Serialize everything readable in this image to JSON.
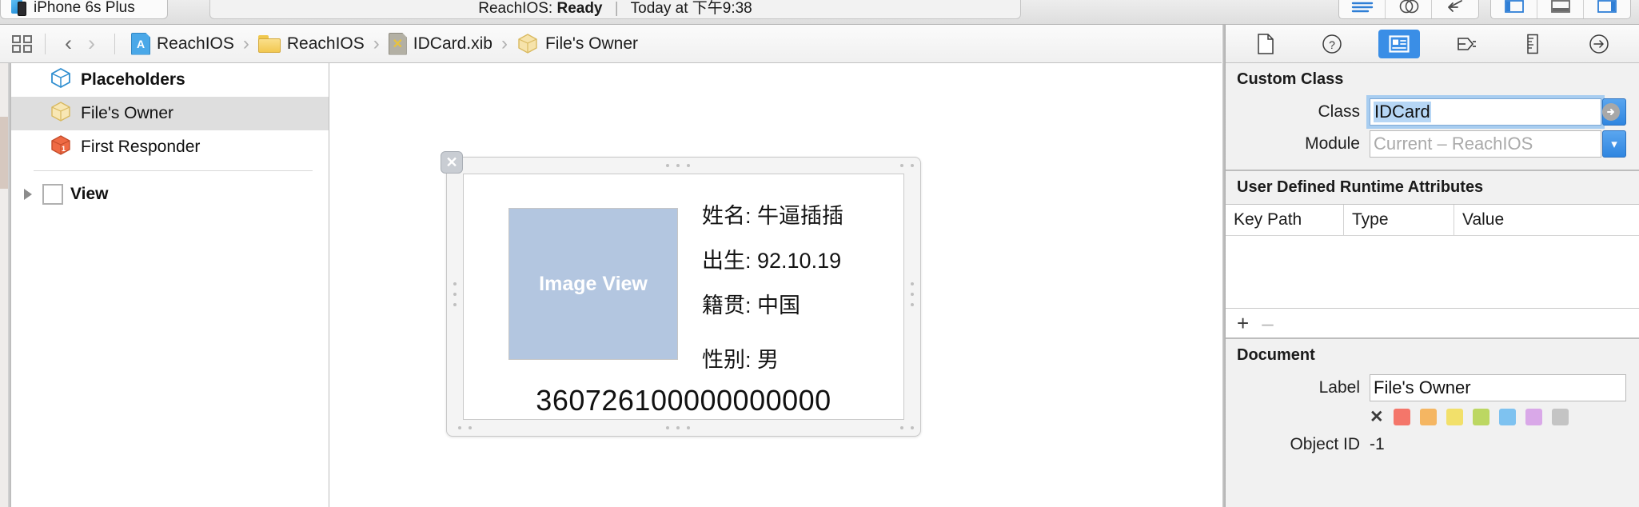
{
  "toolbar": {
    "scheme": "iPhone 6s Plus",
    "device_icon": "iphone-icon",
    "activity_prefix": "ReachIOS:",
    "activity_status": "Ready",
    "activity_separator": "|",
    "activity_time": "Today at 下午9:38",
    "editor_modes": [
      "standard-editor-icon",
      "assistant-editor-icon",
      "version-editor-icon"
    ],
    "panel_toggles": [
      "navigator-toggle-icon",
      "debug-area-toggle-icon",
      "utilities-toggle-icon"
    ]
  },
  "jumpbar": {
    "grid_icon": "related-items-icon",
    "back_icon": "back-chevron-icon",
    "forward_icon": "forward-chevron-icon",
    "separator": "›",
    "crumbs": [
      {
        "label": "ReachIOS",
        "icon": "project-icon"
      },
      {
        "label": "ReachIOS",
        "icon": "folder-icon"
      },
      {
        "label": "IDCard.xib",
        "icon": "xib-file-icon"
      },
      {
        "label": "File's Owner",
        "icon": "cube-icon"
      }
    ]
  },
  "outline": {
    "placeholders": {
      "label": "Placeholders",
      "icon": "blue-cube-icon"
    },
    "items": [
      {
        "label": "File's Owner",
        "icon": "yellow-cube-icon",
        "selected": true
      },
      {
        "label": "First Responder",
        "icon": "first-responder-icon",
        "selected": false
      }
    ],
    "view": {
      "label": "View",
      "icon": "view-square-icon",
      "disclosure": "disclosure-triangle-icon"
    }
  },
  "canvas": {
    "close_badge": "✕",
    "image_view_label": "Image View",
    "image_view_color": "#b3c6e0",
    "fields": [
      "姓名: 牛逼插插",
      "出生: 92.10.19",
      "籍贯: 中国",
      "性别: 男"
    ],
    "id_number": "360726100000000000"
  },
  "inspector": {
    "tabs": [
      {
        "name": "file-inspector",
        "icon": "file-icon",
        "active": false
      },
      {
        "name": "quick-help-inspector",
        "icon": "question-circle-icon",
        "active": false
      },
      {
        "name": "identity-inspector",
        "icon": "identity-card-icon",
        "active": true
      },
      {
        "name": "attributes-inspector",
        "icon": "attributes-slider-icon",
        "active": false
      },
      {
        "name": "size-inspector",
        "icon": "ruler-icon",
        "active": false
      },
      {
        "name": "connections-inspector",
        "icon": "arrow-circle-icon",
        "active": false
      }
    ],
    "custom_class": {
      "title": "Custom Class",
      "class_label": "Class",
      "class_value": "IDCard",
      "module_label": "Module",
      "module_placeholder": "Current – ReachIOS"
    },
    "runtime_attributes": {
      "title": "User Defined Runtime Attributes",
      "columns": [
        "Key Path",
        "Type",
        "Value"
      ],
      "rows": [],
      "add_label": "+",
      "remove_label": "–"
    },
    "document": {
      "title": "Document",
      "label_label": "Label",
      "label_value": "File's Owner",
      "clear_color": "✕",
      "colors": [
        "#f4766a",
        "#f5b662",
        "#f2e06a",
        "#bcd762",
        "#7ec2f0",
        "#d9a8e8",
        "#c4c4c4"
      ],
      "object_id_label": "Object ID",
      "object_id_value": "-1"
    }
  }
}
